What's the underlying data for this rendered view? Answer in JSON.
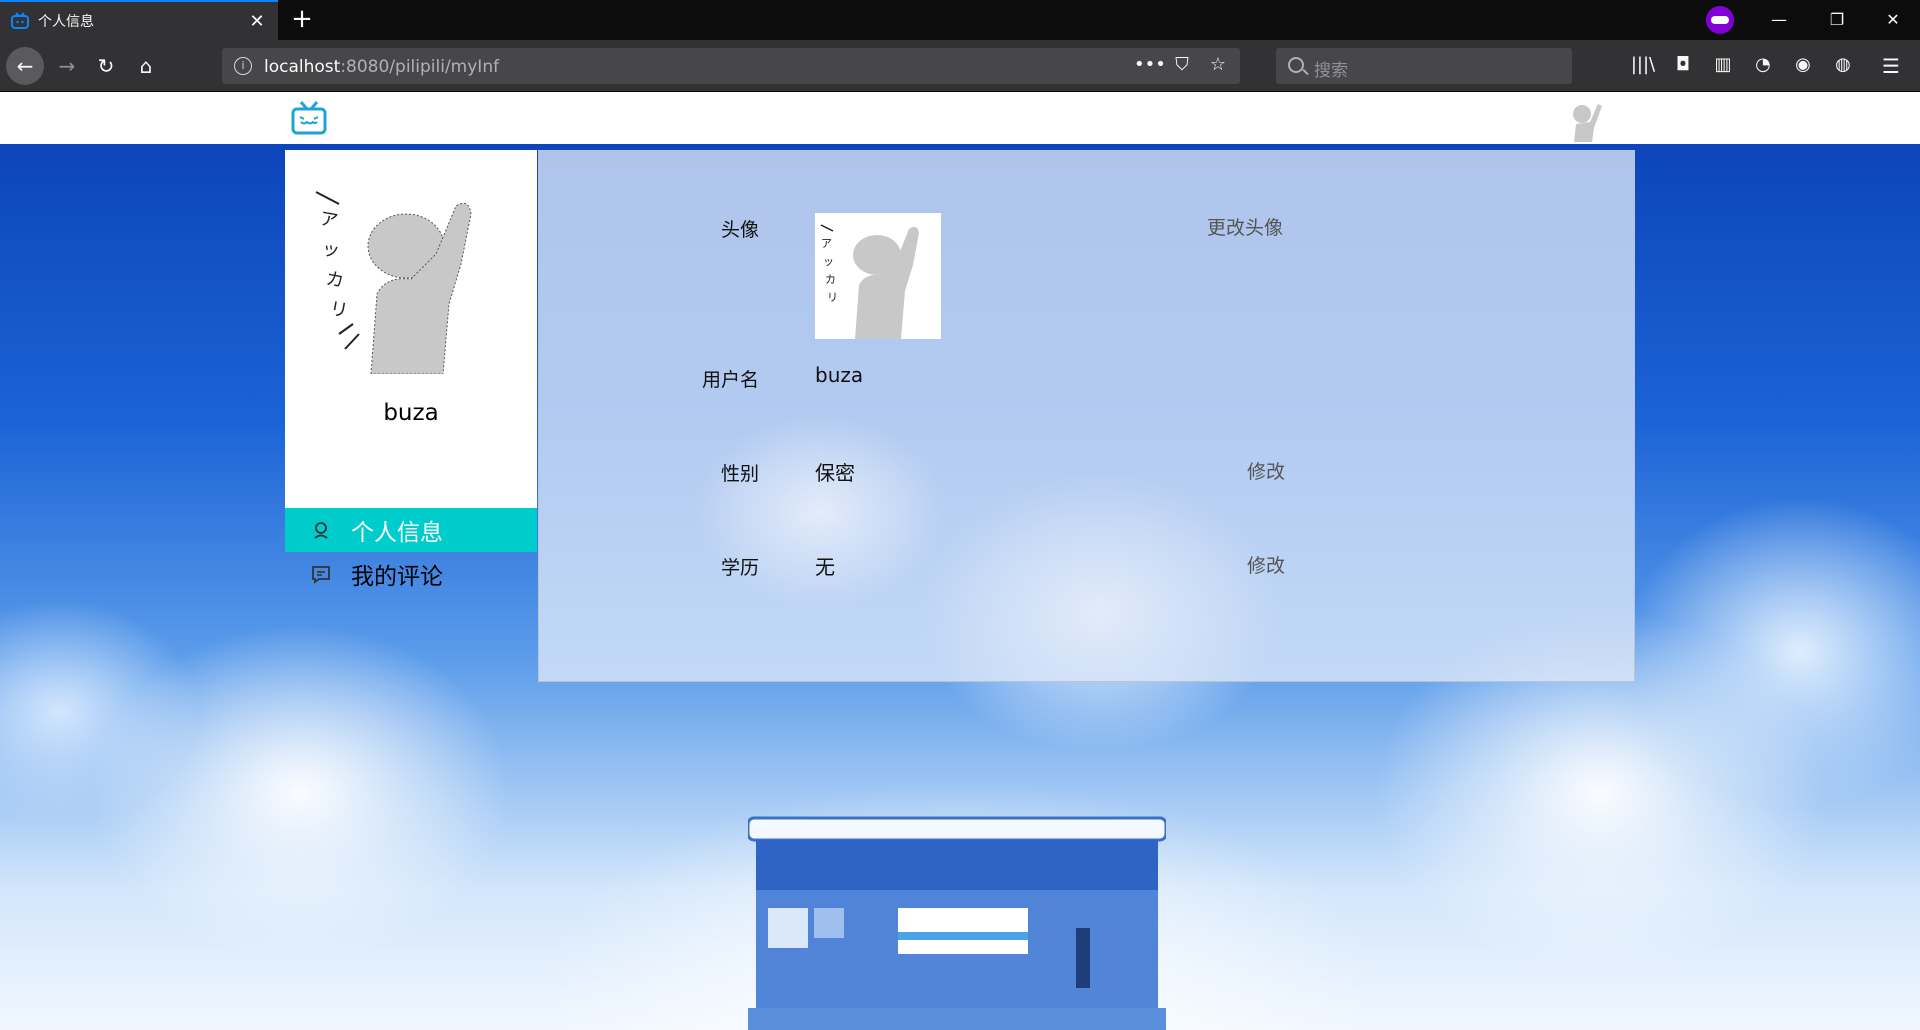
{
  "browser": {
    "tab_title": "个人信息",
    "tab_close": "✕",
    "new_tab": "+",
    "url_host": "localhost",
    "url_rest": ":8080/pilipili/myInf",
    "url_info_glyph": "i",
    "url_actions": [
      "•••",
      "⛉",
      "☆"
    ],
    "search_placeholder": "搜索",
    "toolbar_icons": [
      "|||\\",
      "◘",
      "▥",
      "◔",
      "◉",
      "◍"
    ],
    "menu_glyph": "☰",
    "window_controls": [
      "—",
      "❐",
      "✕"
    ],
    "nav_glyphs": {
      "back": "←",
      "forward": "→",
      "reload": "↻",
      "home": "⌂"
    },
    "private_color": "#8000d7",
    "accent": "#0a84ff"
  },
  "sidebar": {
    "username": "buza",
    "items": [
      {
        "label": "个人信息",
        "icon": "user-icon",
        "active": true
      },
      {
        "label": "我的评论",
        "icon": "comment-icon",
        "active": false
      }
    ],
    "active_color": "#00cccc"
  },
  "profile": {
    "avatar_label": "头像",
    "change_avatar": "更改头像",
    "username_label": "用户名",
    "username_value": "buza",
    "gender_label": "性别",
    "gender_value": "保密",
    "gender_action": "修改",
    "education_label": "学历",
    "education_value": "无",
    "education_action": "修改"
  }
}
